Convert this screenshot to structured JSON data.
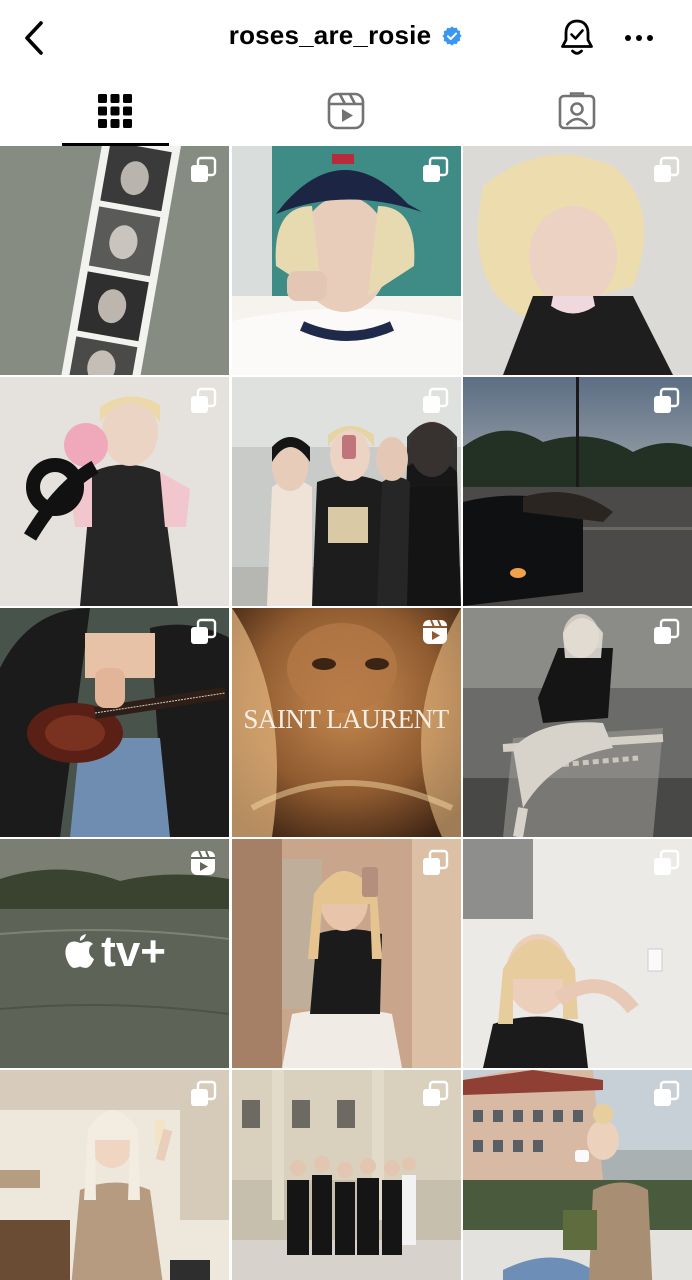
{
  "header": {
    "username": "roses_are_rosie",
    "verified": true,
    "icons": [
      "back-chevron-icon",
      "verified-badge-icon",
      "notification-bell-icon",
      "more-options-icon"
    ],
    "colors": {
      "verified": "#3897f0",
      "text": "#000000"
    }
  },
  "tabs": [
    {
      "name": "posts-grid",
      "icon": "grid-icon",
      "active": true
    },
    {
      "name": "reels",
      "icon": "reels-icon",
      "active": false
    },
    {
      "name": "tagged",
      "icon": "tagged-user-icon",
      "active": false
    }
  ],
  "posts": [
    {
      "badge": "carousel",
      "overlay_text": ""
    },
    {
      "badge": "carousel",
      "overlay_text": ""
    },
    {
      "badge": "carousel",
      "overlay_text": ""
    },
    {
      "badge": "carousel",
      "overlay_text": ""
    },
    {
      "badge": "carousel",
      "overlay_text": ""
    },
    {
      "badge": "carousel",
      "overlay_text": ""
    },
    {
      "badge": "carousel",
      "overlay_text": ""
    },
    {
      "badge": "reel",
      "overlay_text": "SAINT LAURENT"
    },
    {
      "badge": "carousel",
      "overlay_text": ""
    },
    {
      "badge": "reel",
      "overlay_text": "tv+"
    },
    {
      "badge": "carousel",
      "overlay_text": ""
    },
    {
      "badge": "carousel",
      "overlay_text": ""
    },
    {
      "badge": "carousel",
      "overlay_text": ""
    },
    {
      "badge": "carousel",
      "overlay_text": ""
    },
    {
      "badge": "carousel",
      "overlay_text": ""
    }
  ]
}
